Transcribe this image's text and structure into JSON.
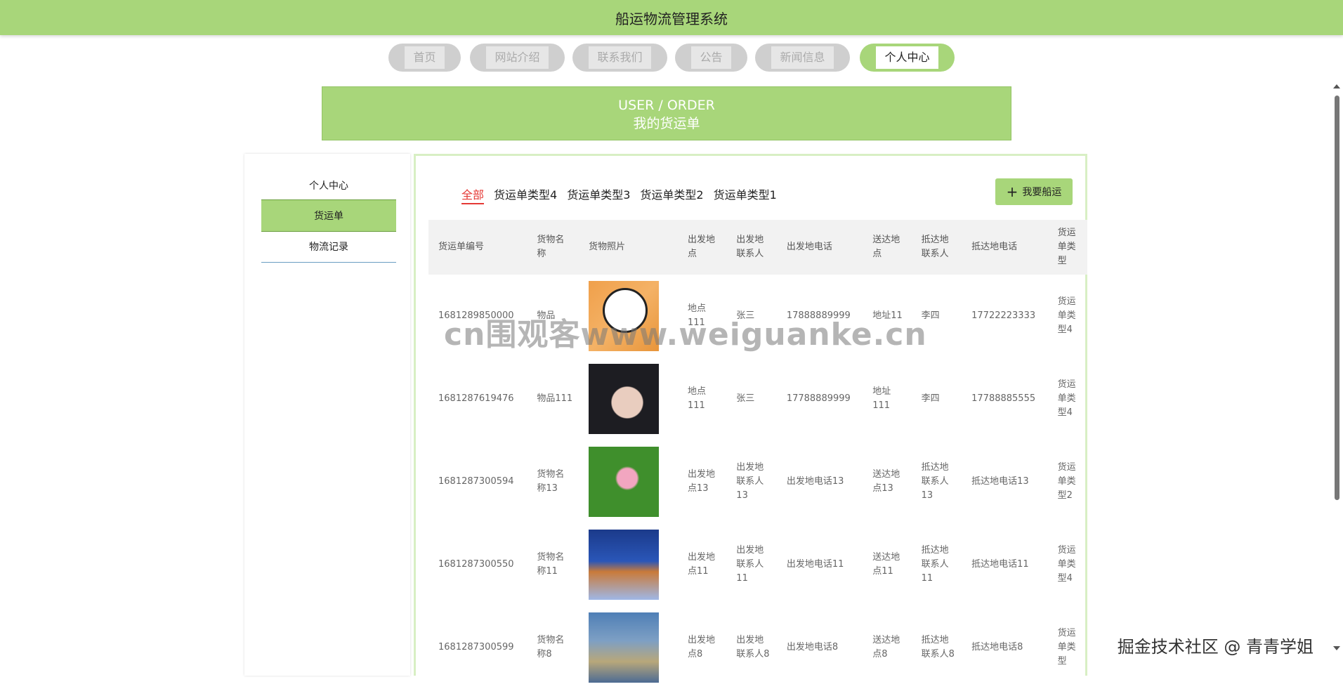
{
  "app": {
    "title": "船运物流管理系统"
  },
  "nav": {
    "items": [
      {
        "label": "首页"
      },
      {
        "label": "网站介绍"
      },
      {
        "label": "联系我们"
      },
      {
        "label": "公告"
      },
      {
        "label": "新闻信息"
      },
      {
        "label": "个人中心"
      }
    ]
  },
  "banner": {
    "en": "USER / ORDER",
    "cn": "我的货运单"
  },
  "sidebar": {
    "items": [
      {
        "label": "个人中心"
      },
      {
        "label": "货运单"
      },
      {
        "label": "物流记录"
      }
    ]
  },
  "tabs": [
    {
      "label": "全部"
    },
    {
      "label": "货运单类型4"
    },
    {
      "label": "货运单类型3"
    },
    {
      "label": "货运单类型2"
    },
    {
      "label": "货运单类型1"
    }
  ],
  "add_button": {
    "label": "我要船运",
    "icon": "plus-icon"
  },
  "table": {
    "headers": [
      "货运单编号",
      "货物名称",
      "货物照片",
      "出发地点",
      "出发地联系人",
      "出发地电话",
      "送达地点",
      "抵达地联系人",
      "抵达地电话",
      "货运单类型"
    ],
    "rows": [
      [
        "1681289850000",
        "物品",
        "",
        "地点111",
        "张三",
        "17888889999",
        "地址11",
        "李四",
        "17722223333",
        "货运单类型4"
      ],
      [
        "1681287619476",
        "物品111",
        "",
        "地点111",
        "张三",
        "17788889999",
        "地址111",
        "李四",
        "17788885555",
        "货运单类型4"
      ],
      [
        "1681287300594",
        "货物名称13",
        "",
        "出发地点13",
        "出发地联系人13",
        "出发地电话13",
        "送达地点13",
        "抵达地联系人13",
        "抵达地电话13",
        "货运单类型2"
      ],
      [
        "1681287300550",
        "货物名称11",
        "",
        "出发地点11",
        "出发地联系人11",
        "出发地电话11",
        "送达地点11",
        "抵达地联系人11",
        "抵达地电话11",
        "货运单类型4"
      ],
      [
        "1681287300599",
        "货物名称8",
        "",
        "出发地点8",
        "出发地联系人8",
        "出发地电话8",
        "送达地点8",
        "抵达地联系人8",
        "抵达地电话8",
        "货运单类型"
      ]
    ]
  },
  "watermarks": {
    "center": "cn围观客www.weiguanke.cn",
    "corner": "掘金技术社区 @ 青青学姐"
  },
  "colors": {
    "accent": "#a8d67a",
    "active_tab": "#e53935"
  }
}
